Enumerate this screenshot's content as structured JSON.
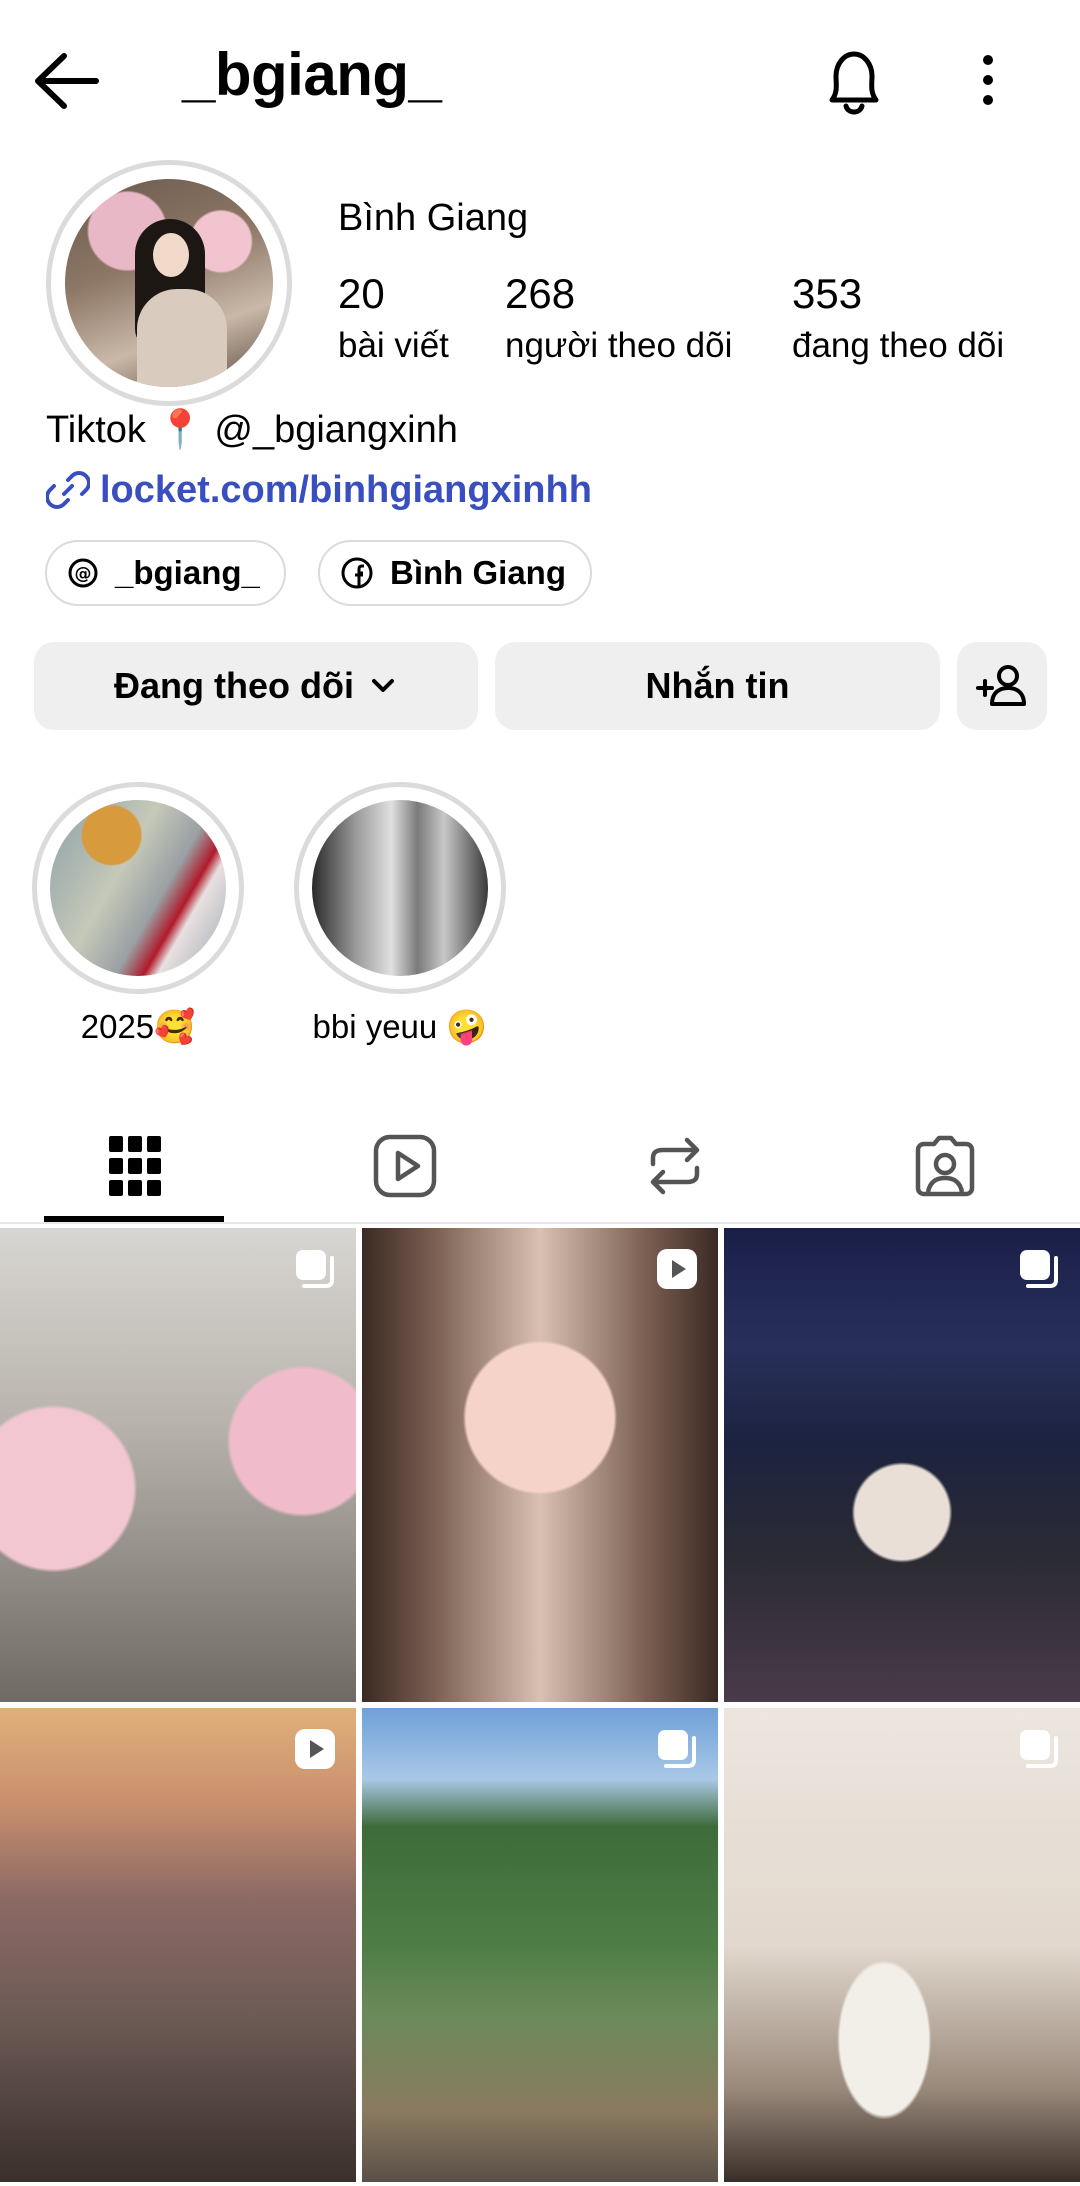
{
  "header": {
    "username": "_bgiang_",
    "back_icon": "arrow-left-icon",
    "bell_icon": "bell-icon",
    "more_icon": "more-vertical-icon"
  },
  "profile": {
    "display_name": "Bình Giang",
    "stats": [
      {
        "value": "20",
        "label": "bài viết"
      },
      {
        "value": "268",
        "label": "người theo dõi"
      },
      {
        "value": "353",
        "label": "đang theo dõi"
      }
    ],
    "bio": "Tiktok 📍 @_bgiangxinh",
    "link": "locket.com/binhgiangxinhh",
    "chips": [
      {
        "icon": "threads-icon",
        "label": "_bgiang_"
      },
      {
        "icon": "facebook-icon",
        "label": "Bình Giang"
      }
    ]
  },
  "actions": {
    "following_label": "Đang theo dõi",
    "message_label": "Nhắn tin",
    "add_person_icon": "add-person-icon"
  },
  "highlights": [
    {
      "label": "2025🥰"
    },
    {
      "label": "bbi yeuu 🤪"
    }
  ],
  "tabs": [
    {
      "name": "posts",
      "icon": "grid-icon",
      "active": true
    },
    {
      "name": "reels",
      "icon": "reels-icon",
      "active": false
    },
    {
      "name": "reposts",
      "icon": "repost-icon",
      "active": false
    },
    {
      "name": "tagged",
      "icon": "tagged-person-icon",
      "active": false
    }
  ],
  "posts": [
    {
      "type": "carousel",
      "badge_icon": "carousel-icon"
    },
    {
      "type": "reel",
      "badge_icon": "reel-icon"
    },
    {
      "type": "carousel",
      "badge_icon": "carousel-icon"
    },
    {
      "type": "reel",
      "badge_icon": "reel-icon"
    },
    {
      "type": "carousel",
      "badge_icon": "carousel-icon"
    },
    {
      "type": "carousel",
      "badge_icon": "carousel-icon"
    }
  ],
  "colors": {
    "link": "#3a4fbf",
    "button_bg": "#efefef",
    "ring": "#dbdbdb"
  }
}
